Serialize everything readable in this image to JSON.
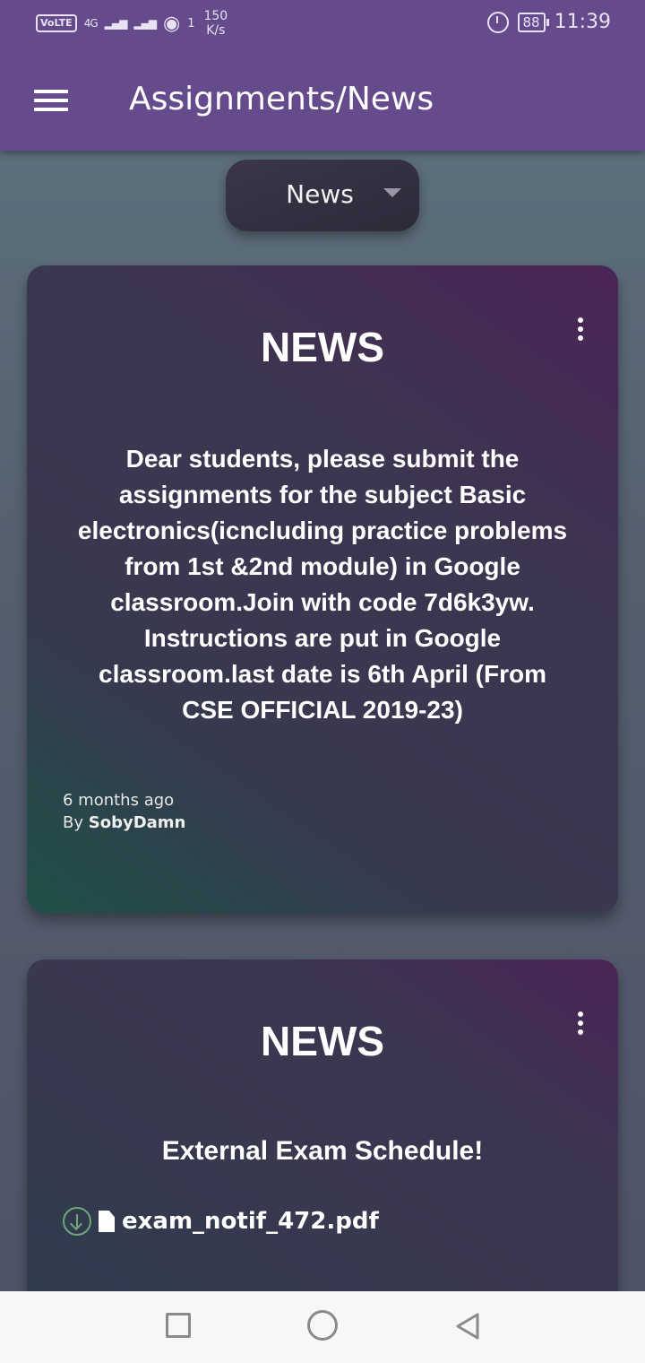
{
  "status_bar": {
    "volte": "VoLTE",
    "network_4g": "4G",
    "net_speed_value": "150",
    "net_speed_unit": "K/s",
    "hotspot_count": "1",
    "battery": "88",
    "time": "11:39"
  },
  "app_bar": {
    "title": "Assignments/News"
  },
  "filter": {
    "selected": "News"
  },
  "cards": [
    {
      "title": "NEWS",
      "body": "Dear students, please submit the assignments for the subject Basic electronics(icncluding practice problems from 1st &2nd module) in Google classroom.Join with code 7d6k3yw. Instructions are put in Google classroom.last date is 6th April (From CSE OFFICIAL 2019-23)",
      "time_ago": "6 months ago",
      "by_prefix": "By",
      "author": "SobyDamn"
    },
    {
      "title": "NEWS",
      "body": "External Exam Schedule!",
      "attachment": "exam_notif_472.pdf"
    }
  ],
  "colors": {
    "app_bar": "#654a8c",
    "download_icon": "#6fa77c"
  }
}
